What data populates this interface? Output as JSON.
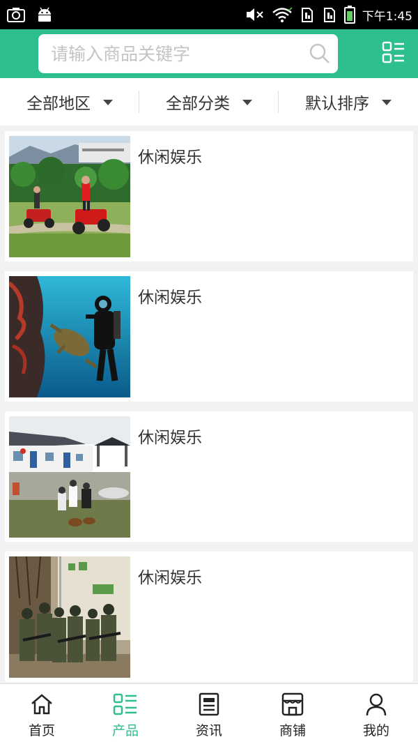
{
  "status_bar": {
    "time": "下午1:45"
  },
  "search": {
    "placeholder": "请输入商品关键字",
    "value": ""
  },
  "filters": [
    {
      "label": "全部地区"
    },
    {
      "label": "全部分类"
    },
    {
      "label": "默认排序"
    }
  ],
  "products": [
    {
      "title": "休闲娱乐",
      "image": "atv-riders-photo"
    },
    {
      "title": "休闲娱乐",
      "image": "scuba-diver-turtle-photo"
    },
    {
      "title": "休闲娱乐",
      "image": "courtyard-mahjong-photo"
    },
    {
      "title": "休闲娱乐",
      "image": "paintball-soldiers-photo"
    }
  ],
  "bottom_nav": [
    {
      "label": "首页",
      "icon": "home-icon"
    },
    {
      "label": "产品",
      "icon": "product-grid-icon",
      "active": true
    },
    {
      "label": "资讯",
      "icon": "news-icon"
    },
    {
      "label": "商铺",
      "icon": "shop-icon"
    },
    {
      "label": "我的",
      "icon": "user-icon"
    }
  ],
  "colors": {
    "accent": "#2ebf8e",
    "status_bar": "#000000",
    "background": "#f2f2f2"
  }
}
